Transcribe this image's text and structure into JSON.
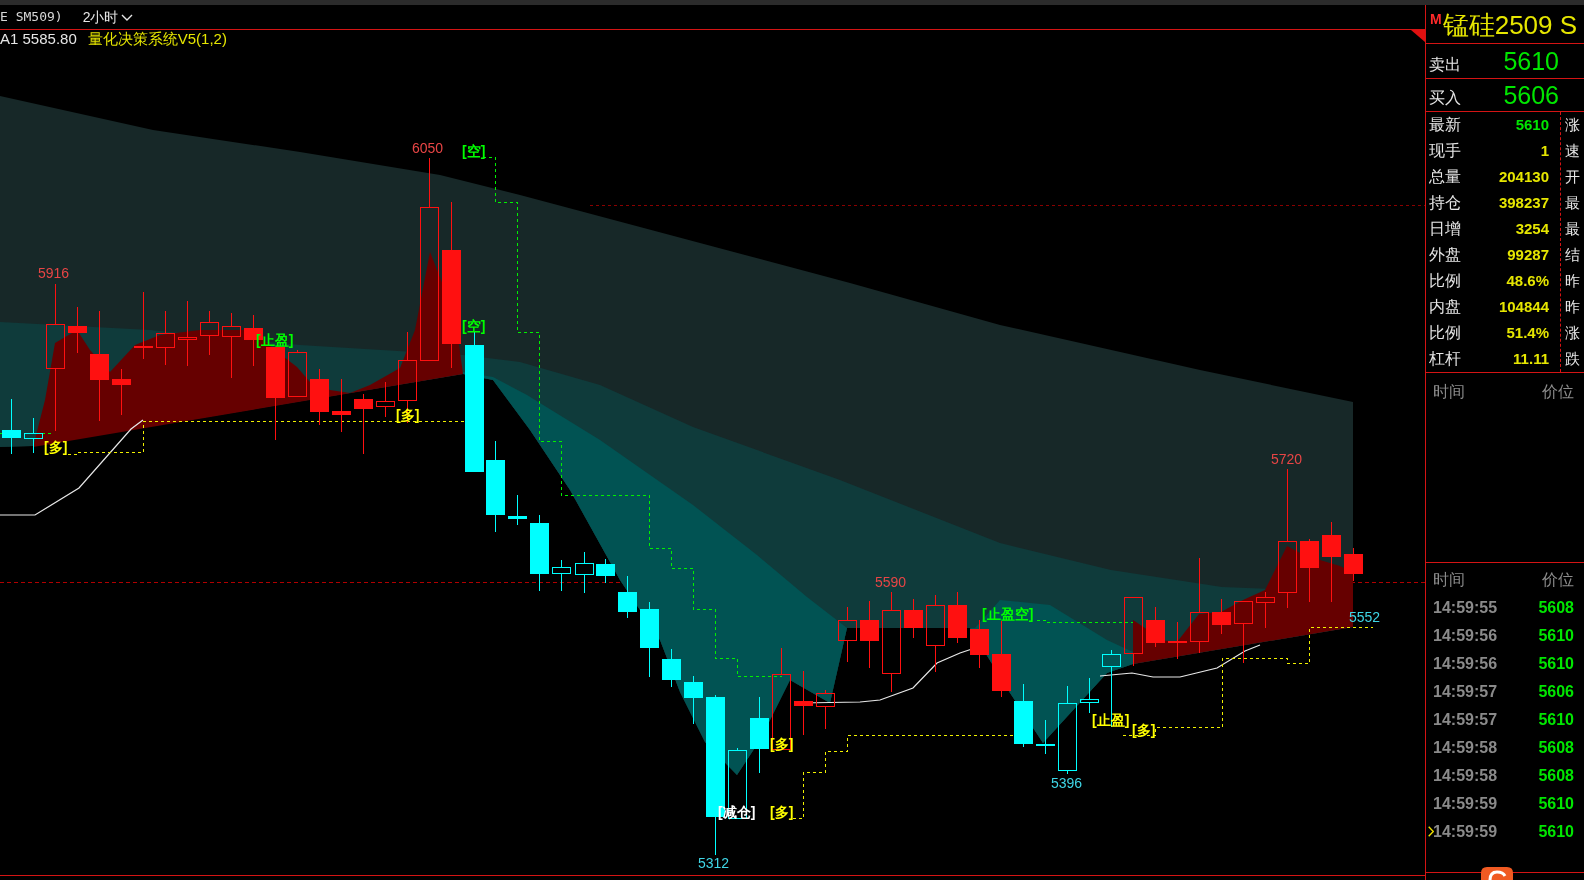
{
  "header": {
    "contract": "E SM509)",
    "period": "2小时"
  },
  "legend": [
    {
      "text": "A1 5585.80",
      "color": "#e6e6e6"
    },
    {
      "text": "量化决策系统V5(1,2)",
      "color": "#e6e600"
    }
  ],
  "chart": {
    "price_labels": [
      {
        "text": "5916",
        "color": "#e84545"
      },
      {
        "text": "6050",
        "color": "#e84545"
      },
      {
        "text": "5312",
        "color": "#3fd6e6"
      },
      {
        "text": "5590",
        "color": "#e84545"
      },
      {
        "text": "5396",
        "color": "#3fd6e6"
      },
      {
        "text": "5720",
        "color": "#e84545"
      },
      {
        "text": "5552",
        "color": "#3fd6e6"
      }
    ],
    "signals": [
      {
        "text": "[多]",
        "color": "#ffff00"
      },
      {
        "text": "[止盈]",
        "color": "#00ff00"
      },
      {
        "text": "[多]",
        "color": "#ffff00"
      },
      {
        "text": "[空]",
        "color": "#00ff00"
      },
      {
        "text": "[空]",
        "color": "#00ff00"
      },
      {
        "text": "[减仓]",
        "color": "#ffffff"
      },
      {
        "text": "[多]",
        "color": "#ffff00"
      },
      {
        "text": "[多]",
        "color": "#ffff00"
      },
      {
        "text": "[止盈空]",
        "color": "#00ff00"
      },
      {
        "text": "[止盈]",
        "color": "#ffff00"
      },
      {
        "text": "[多]",
        "color": "#ffff00"
      }
    ]
  },
  "quote": {
    "badge": "M",
    "title": "锰硅2509 S",
    "ask": {
      "label": "卖出",
      "price": "5610"
    },
    "bid": {
      "label": "买入",
      "price": "5606"
    },
    "stats": [
      {
        "label": "最新",
        "value": "5610",
        "color": "#00e600",
        "column_3": "涨"
      },
      {
        "label": "现手",
        "value": "1",
        "color": "#e6e600",
        "column_3": "速"
      },
      {
        "label": "总量",
        "value": "204130",
        "color": "#e6e600",
        "column_3": "开"
      },
      {
        "label": "持仓",
        "value": "398237",
        "color": "#e6e600",
        "column_3": "最"
      },
      {
        "label": "日增",
        "value": "3254",
        "color": "#e6e600",
        "column_3": "最"
      },
      {
        "label": "外盘",
        "value": "99287",
        "color": "#e6e600",
        "column_3": "结"
      },
      {
        "label": "比例",
        "value": "48.6%",
        "color": "#e6e600",
        "column_3": "昨"
      },
      {
        "label": "内盘",
        "value": "104844",
        "color": "#e6e600",
        "column_3": "昨"
      },
      {
        "label": "比例",
        "value": "51.4%",
        "color": "#e6e600",
        "column_3": "涨"
      },
      {
        "label": "杠杆",
        "value": "11.11",
        "color": "#e6e600",
        "column_3": "跌"
      }
    ],
    "trades": {
      "columns": [
        "时间",
        "价位"
      ]
    },
    "ticks": {
      "columns": [
        "时间",
        "价位"
      ],
      "rows": [
        {
          "time": "14:59:55",
          "price": "5608",
          "selected": false
        },
        {
          "time": "14:59:56",
          "price": "5610",
          "selected": false
        },
        {
          "time": "14:59:56",
          "price": "5610",
          "selected": false
        },
        {
          "time": "14:59:57",
          "price": "5606",
          "selected": false
        },
        {
          "time": "14:59:57",
          "price": "5610",
          "selected": false
        },
        {
          "time": "14:59:58",
          "price": "5608",
          "selected": false
        },
        {
          "time": "14:59:58",
          "price": "5608",
          "selected": false
        },
        {
          "time": "14:59:59",
          "price": "5610",
          "selected": false
        },
        {
          "time": "14:59:59",
          "price": "5610",
          "selected": true
        }
      ]
    }
  }
}
